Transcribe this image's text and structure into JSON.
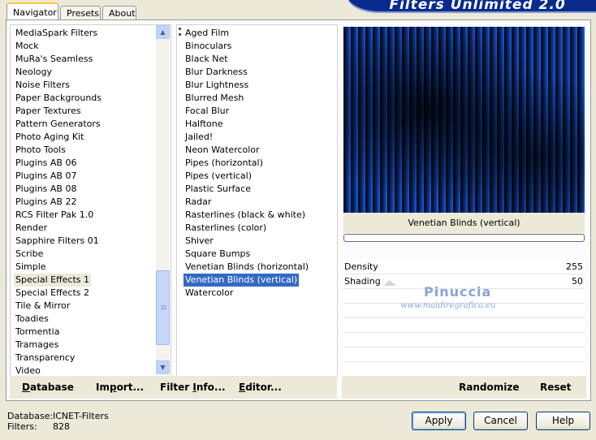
{
  "banner": {
    "title": "Filters Unlimited 2.0"
  },
  "tabs": [
    {
      "label": "Navigator",
      "active": true
    },
    {
      "label": "Presets",
      "active": false
    },
    {
      "label": "About",
      "active": false
    }
  ],
  "categories": {
    "selected_index": 19,
    "items": [
      "MediaSpark Filters",
      "Mock",
      "MuRa's Seamless",
      "Neology",
      "Noise Filters",
      "Paper Backgrounds",
      "Paper Textures",
      "Pattern Generators",
      "Photo Aging Kit",
      "Photo Tools",
      "Plugins AB 06",
      "Plugins AB 07",
      "Plugins AB 08",
      "Plugins AB 22",
      "RCS Filter Pak 1.0",
      "Render",
      "Sapphire Filters 01",
      "Scribe",
      "Simple",
      "Special Effects 1",
      "Special Effects 2",
      "Tile & Mirror",
      "Toadies",
      "Tormentia",
      "Tramages",
      "Transparency",
      "Video"
    ]
  },
  "filters": {
    "selected_index": 19,
    "items": [
      "Aged Film",
      "Binoculars",
      "Black Net",
      "Blur Darkness",
      "Blur Lightness",
      "Blurred Mesh",
      "Focal Blur",
      "Halftone",
      "Jailed!",
      "Neon Watercolor",
      "Pipes (horizontal)",
      "Pipes (vertical)",
      "Plastic Surface",
      "Radar",
      "Rasterlines (black & white)",
      "Rasterlines (color)",
      "Shiver",
      "Square Bumps",
      "Venetian Blinds (horizontal)",
      "Venetian Blinds (vertical)",
      "Watercolor"
    ]
  },
  "preview": {
    "filter_name": "Venetian Blinds (vertical)",
    "progress": 0
  },
  "params": [
    {
      "label": "Density",
      "value": "255"
    },
    {
      "label": "Shading",
      "value": "50"
    }
  ],
  "watermark": {
    "name": "Pinuccia",
    "url": "www.maidiregrafica.eu"
  },
  "left_bar": {
    "database": {
      "underline": "D",
      "rest": "atabase"
    },
    "import": {
      "pre": "Im",
      "underline": "p",
      "rest": "ort..."
    },
    "filter_info": {
      "pre": "Filter ",
      "underline": "I",
      "rest": "nfo..."
    },
    "editor": {
      "underline": "E",
      "rest": "ditor..."
    }
  },
  "right_bar": {
    "randomize": "Randomize",
    "reset": "Reset"
  },
  "status": {
    "database_label": "Database:",
    "database_value": "ICNET-Filters",
    "filters_label": "Filters:",
    "filters_value": "828"
  },
  "dialog": {
    "apply": "Apply",
    "cancel": "Cancel",
    "help": "Help"
  },
  "colors": {
    "selection": "#316ac5",
    "banner": "#0a2a8c",
    "preview_blue": "#0a3fa8"
  }
}
